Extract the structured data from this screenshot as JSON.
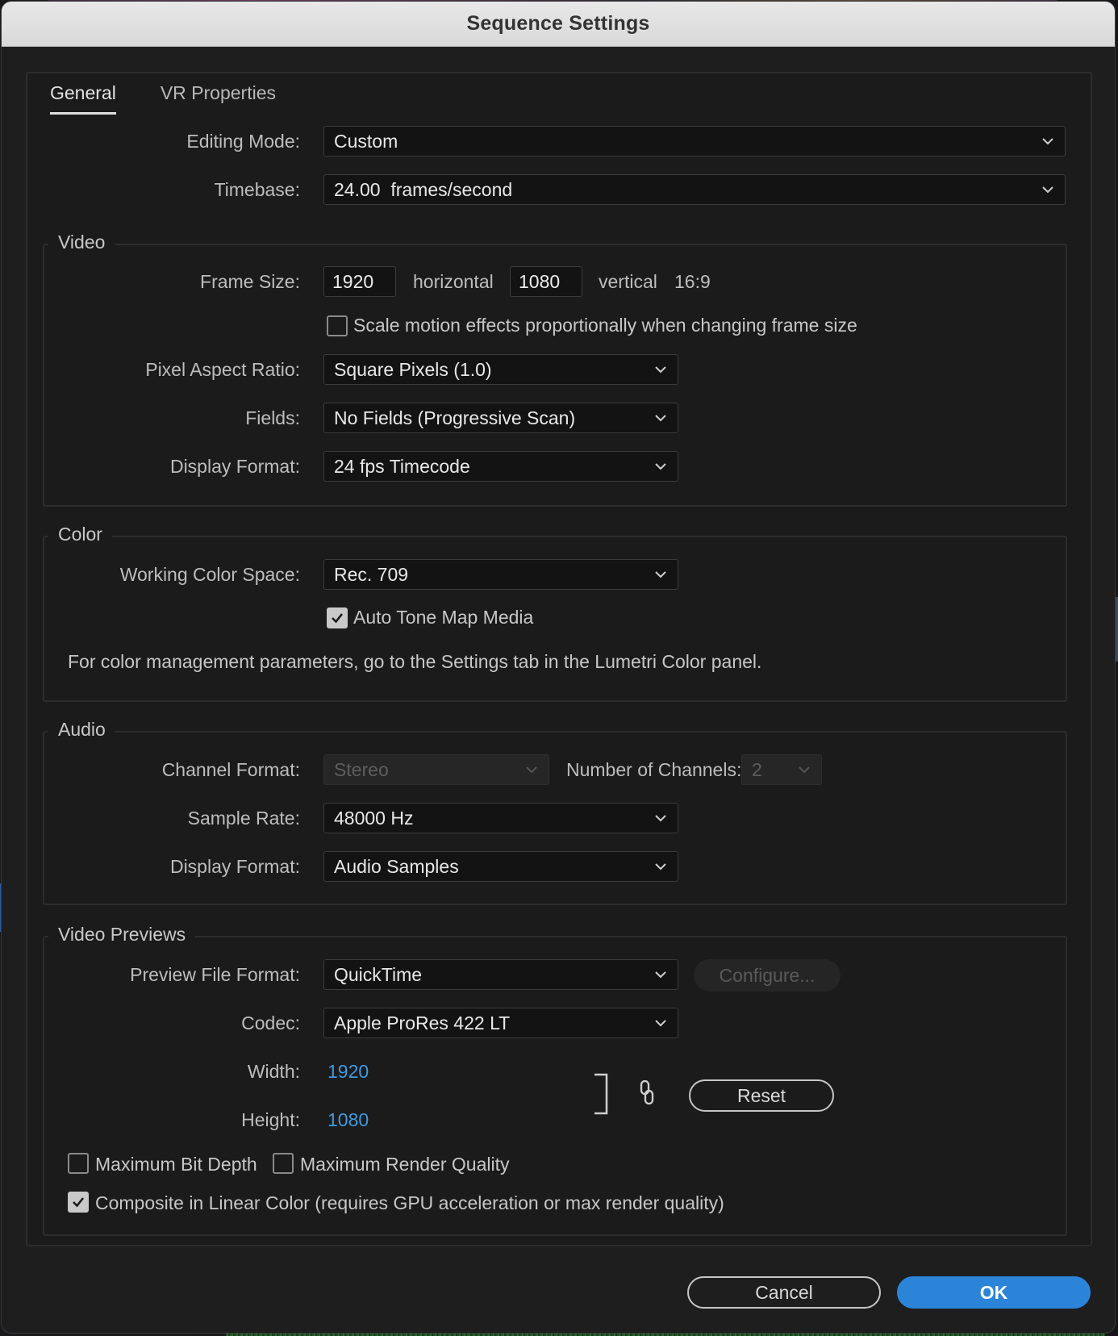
{
  "window": {
    "title": "Sequence Settings"
  },
  "tabs": [
    {
      "label": "General",
      "active": true
    },
    {
      "label": "VR Properties",
      "active": false
    }
  ],
  "general": {
    "editing_mode": {
      "label": "Editing Mode:",
      "value": "Custom"
    },
    "timebase": {
      "label": "Timebase:",
      "value": "24.00  frames/second"
    }
  },
  "video": {
    "title": "Video",
    "frame_size": {
      "label": "Frame Size:",
      "horizontal_value": "1920",
      "horizontal_label": "horizontal",
      "vertical_value": "1080",
      "vertical_label": "vertical",
      "aspect": "16:9"
    },
    "scale_motion": {
      "label": "Scale motion effects proportionally when changing frame size",
      "checked": false
    },
    "pixel_aspect_ratio": {
      "label": "Pixel Aspect Ratio:",
      "value": "Square Pixels (1.0)"
    },
    "fields": {
      "label": "Fields:",
      "value": "No Fields (Progressive Scan)"
    },
    "display_format": {
      "label": "Display Format:",
      "value": "24 fps Timecode"
    }
  },
  "color": {
    "title": "Color",
    "working_color_space": {
      "label": "Working Color Space:",
      "value": "Rec. 709"
    },
    "auto_tone_map": {
      "label": "Auto Tone Map Media",
      "checked": true
    },
    "note": "For color management parameters, go to the Settings tab in the Lumetri Color panel."
  },
  "audio": {
    "title": "Audio",
    "channel_format": {
      "label": "Channel Format:",
      "value": "Stereo"
    },
    "number_of_channels": {
      "label": "Number of Channels:",
      "value": "2"
    },
    "sample_rate": {
      "label": "Sample Rate:",
      "value": "48000 Hz"
    },
    "display_format": {
      "label": "Display Format:",
      "value": "Audio Samples"
    }
  },
  "video_previews": {
    "title": "Video Previews",
    "preview_file_format": {
      "label": "Preview File Format:",
      "value": "QuickTime"
    },
    "configure_label": "Configure...",
    "codec": {
      "label": "Codec:",
      "value": "Apple ProRes 422 LT"
    },
    "width": {
      "label": "Width:",
      "value": "1920"
    },
    "height": {
      "label": "Height:",
      "value": "1080"
    },
    "reset_label": "Reset",
    "max_bit_depth": {
      "label": "Maximum Bit Depth",
      "checked": false
    },
    "max_render_quality": {
      "label": "Maximum Render Quality",
      "checked": false
    },
    "composite_linear": {
      "label": "Composite in Linear Color (requires GPU acceleration or max render quality)",
      "checked": true
    }
  },
  "footer": {
    "cancel_label": "Cancel",
    "ok_label": "OK"
  },
  "colors": {
    "accent": "#2b84d8",
    "link": "#3d9be0",
    "titlebar": "#e0e0e0",
    "background": "#1e1e1e"
  }
}
